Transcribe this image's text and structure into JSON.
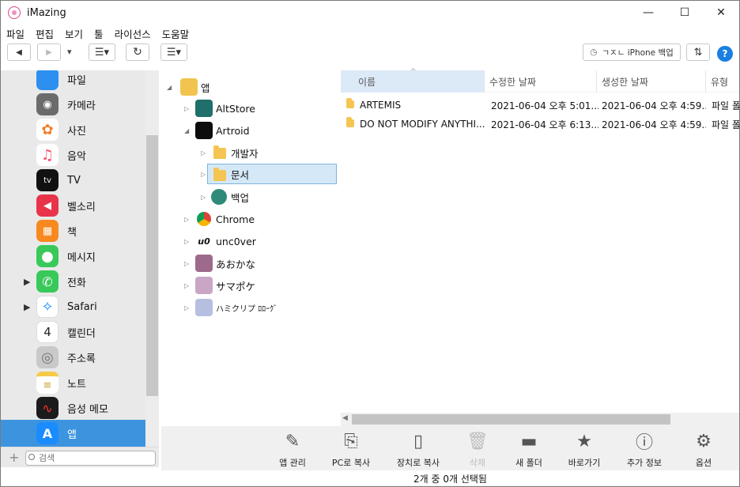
{
  "window": {
    "title": "iMazing",
    "minimize": "—",
    "maximize": "☐",
    "close": "✕"
  },
  "menu": [
    "파일",
    "편집",
    "보기",
    "툴",
    "라이선스",
    "도움말"
  ],
  "toolbar": {
    "backup_label": "ㄱㅈㄴ iPhone 백업",
    "help": "?",
    "back": "◀",
    "forward": "▶",
    "dropdown": "▾",
    "refresh": "↻",
    "sort": "⇅"
  },
  "sidebar": {
    "items": [
      {
        "label": "파일",
        "color": "#2d8ff0",
        "glyph": "▬"
      },
      {
        "label": "카메라",
        "color": "#6b6b6b",
        "glyph": "◉"
      },
      {
        "label": "사진",
        "color": "#f7a23a",
        "glyph": "✿"
      },
      {
        "label": "음악",
        "color": "#fb4a66",
        "glyph": "♫"
      },
      {
        "label": "TV",
        "color": "#111111",
        "glyph": "tv"
      },
      {
        "label": "벨소리",
        "color": "#e8344a",
        "glyph": "◀"
      },
      {
        "label": "책",
        "color": "#f7891f",
        "glyph": "▦"
      },
      {
        "label": "메시지",
        "color": "#38c95a",
        "glyph": "●"
      },
      {
        "label": "전화",
        "color": "#38c95a",
        "glyph": "✆"
      },
      {
        "label": "Safari",
        "color": "#1a8cff",
        "glyph": "✧"
      },
      {
        "label": "캘린더",
        "color": "#ffffff",
        "glyph": "4"
      },
      {
        "label": "주소록",
        "color": "#9a9a9a",
        "glyph": "◎"
      },
      {
        "label": "노트",
        "color": "#f6c94a",
        "glyph": "≡"
      },
      {
        "label": "음성 메모",
        "color": "#1b1b1b",
        "glyph": "∿"
      },
      {
        "label": "앱",
        "color": "#1a8cff",
        "glyph": "A"
      }
    ],
    "search_placeholder": "검색",
    "add": "+"
  },
  "tree": [
    {
      "label": "앱",
      "icon": "apps-folder"
    },
    {
      "label": "AltStore",
      "icon": "altstore"
    },
    {
      "label": "Artroid",
      "icon": "artroid"
    },
    {
      "label": "개발자",
      "icon": "folder"
    },
    {
      "label": "문서",
      "icon": "folder"
    },
    {
      "label": "백업",
      "icon": "backup"
    },
    {
      "label": "Chrome",
      "icon": "chrome"
    },
    {
      "label": "unc0ver",
      "icon": "unc0ver"
    },
    {
      "label": "あおかな",
      "icon": "anime"
    },
    {
      "label": "サマポケ",
      "icon": "anime"
    },
    {
      "label": "ハミクリプ ﾛﾛｰｸﾞ",
      "icon": "anime"
    }
  ],
  "list": {
    "columns": [
      "이름",
      "수정한 날짜",
      "생성한 날짜",
      "유형"
    ],
    "rows": [
      {
        "name": "ARTEMIS",
        "modified": "2021-06-04 오후 5:01...",
        "created": "2021-06-04 오후 4:59...",
        "type": "파일 폴"
      },
      {
        "name": "DO NOT MODIFY ANYTHI...",
        "modified": "2021-06-04 오후 6:13...",
        "created": "2021-06-04 오후 4:59...",
        "type": "파일 폴"
      }
    ]
  },
  "actions": [
    {
      "label": "앱 관리",
      "glyph": "✎",
      "enabled": true
    },
    {
      "label": "PC로 복사",
      "glyph": "⎘",
      "enabled": true
    },
    {
      "label": "장치로 복사",
      "glyph": "▯",
      "enabled": true
    },
    {
      "label": "삭제",
      "glyph": "🗑",
      "enabled": false
    },
    {
      "label": "새 폴더",
      "glyph": "▬",
      "enabled": true
    },
    {
      "label": "바로가기",
      "glyph": "★",
      "enabled": true
    },
    {
      "label": "추가 정보",
      "glyph": "ⓘ",
      "enabled": true
    },
    {
      "label": "옵션",
      "glyph": "⚙",
      "enabled": true
    }
  ],
  "status": "2개 중 0개 선택됨"
}
